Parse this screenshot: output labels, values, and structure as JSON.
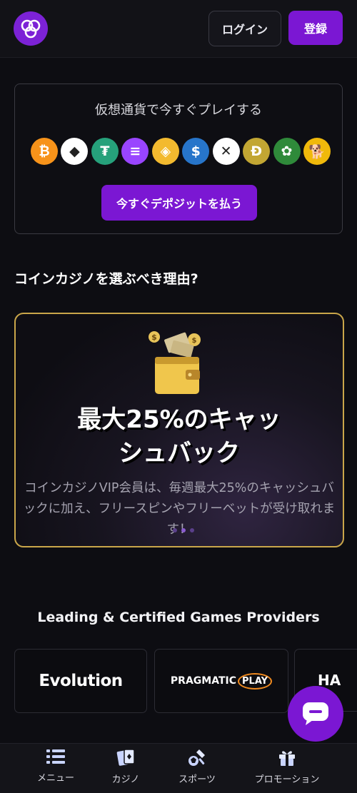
{
  "header": {
    "login_label": "ログイン",
    "register_label": "登録",
    "accent_color": "#7b17d3"
  },
  "crypto": {
    "title": "仮想通貨で今すぐプレイする",
    "coins": [
      {
        "icon": "bitcoin-icon",
        "color": "#f7931a",
        "glyph": "₿"
      },
      {
        "icon": "ethereum-icon",
        "color": "#ffffff",
        "glyph": "◆"
      },
      {
        "icon": "tether-icon",
        "color": "#26a17b",
        "glyph": "₮"
      },
      {
        "icon": "solana-icon",
        "color": "#9945ff",
        "glyph": "≡"
      },
      {
        "icon": "binance-icon",
        "color": "#f3ba2f",
        "glyph": "◈"
      },
      {
        "icon": "usdc-icon",
        "color": "#2775ca",
        "glyph": "$"
      },
      {
        "icon": "xrp-icon",
        "color": "#ffffff",
        "glyph": "✕"
      },
      {
        "icon": "dogecoin-icon",
        "color": "#c2a633",
        "glyph": "Ð"
      },
      {
        "icon": "rose-coin-icon",
        "color": "#2f8a3a",
        "glyph": "✿"
      },
      {
        "icon": "shiba-icon",
        "color": "#f0b90b",
        "glyph": "🐕"
      }
    ],
    "deposit_label": "今すぐデポジットを払う"
  },
  "reasons": {
    "title": "コインカジノを選ぶべき理由?"
  },
  "promo": {
    "headline_line1": "最大25%のキャッ",
    "headline_line2": "シュバック",
    "description": "コインカジノVIP会員は、毎週最大25%のキャッシュバックに加え、フリースピンやフリーベットが受け取れます！"
  },
  "providers": {
    "title": "Leading & Certified Games Providers",
    "items": [
      {
        "name": "Evolution"
      },
      {
        "name": "PRAGMATIC",
        "suffix": "PLAY"
      },
      {
        "name": "HA"
      }
    ]
  },
  "nav": {
    "menu": "メニュー",
    "casino": "カジノ",
    "sports": "スポーツ",
    "promotion": "プロモーション"
  }
}
